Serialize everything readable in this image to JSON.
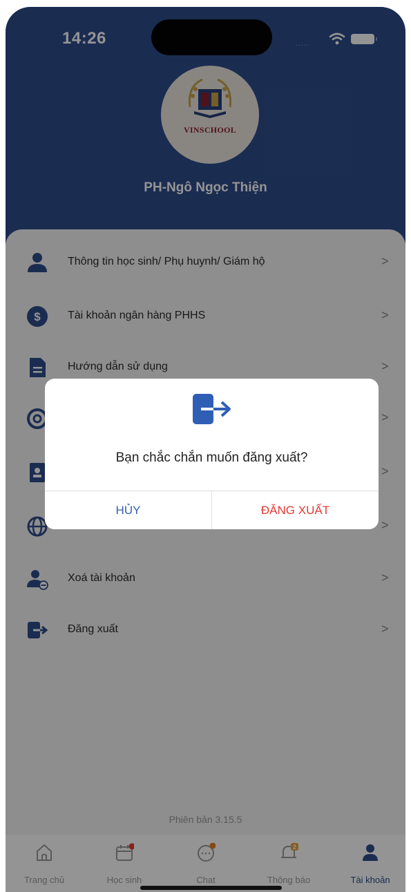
{
  "status_bar": {
    "time": "14:26",
    "signal": "....."
  },
  "profile": {
    "logo_text": "VINSCHOOL",
    "name": "PH-Ngô Ngọc Thiện"
  },
  "menu": {
    "items": [
      {
        "label": "Thông tin học sinh/ Phụ huynh/ Giám hộ",
        "icon": "person-icon"
      },
      {
        "label": "Tài khoản ngân hàng PHHS",
        "icon": "dollar-icon"
      },
      {
        "label": "Hướng dẫn sử dụng",
        "icon": "document-icon"
      },
      {
        "label": "",
        "icon": "support-icon"
      },
      {
        "label": "",
        "icon": "contacts-icon"
      },
      {
        "label": "",
        "icon": "globe-icon"
      },
      {
        "label": "Xoá tài khoản",
        "icon": "delete-user-icon"
      },
      {
        "label": "Đăng xuất",
        "icon": "logout-icon"
      }
    ],
    "chevron": ">"
  },
  "version": "Phiên bản 3.15.5",
  "tabs": [
    {
      "label": "Trang chủ",
      "icon": "home-icon",
      "badge": ""
    },
    {
      "label": "Học sinh",
      "icon": "calendar-icon",
      "badge": "dot"
    },
    {
      "label": "Chat",
      "icon": "chat-icon",
      "badge": "dot"
    },
    {
      "label": "Thông báo",
      "icon": "bell-icon",
      "badge": "2"
    },
    {
      "label": "Tài khoản",
      "icon": "account-icon",
      "badge": "",
      "active": true
    }
  ],
  "dialog": {
    "message": "Bạn chắc chắn muốn đăng xuất?",
    "cancel_label": "HỦY",
    "confirm_label": "ĐĂNG XUẤT"
  },
  "colors": {
    "header": "#2f4d8c",
    "primary": "#2f5fb5",
    "danger": "#e53935",
    "badge_red": "#e53935",
    "badge_orange": "#e67e22"
  }
}
